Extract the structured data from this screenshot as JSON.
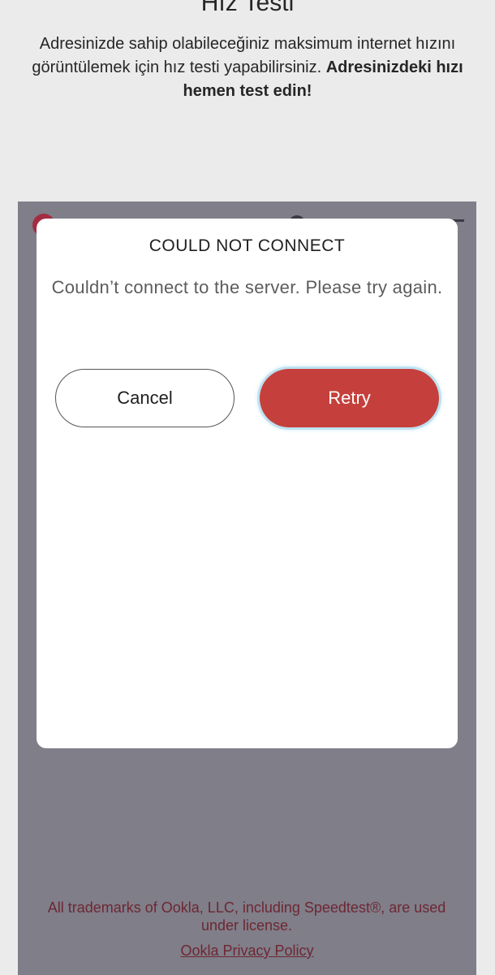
{
  "header": {
    "title": "Hız Testi",
    "intro_text": "Adresinizde sahip olabileceğiniz maksimum internet hızını görüntülemek için hız testi yapabilirsiniz.",
    "intro_bold": "Adresinizdeki hızı hemen test edin!"
  },
  "dialog": {
    "title": "COULD NOT CONNECT",
    "message": "Couldn’t connect to the server. Please try again.",
    "cancel_label": "Cancel",
    "retry_label": "Retry"
  },
  "footer": {
    "legal": "All trademarks of Ookla, LLC, including Speedtest®, are used under license.",
    "privacy_link": "Ookla Privacy Policy"
  },
  "colors": {
    "retry_button": "#c5403c",
    "overlay": "#7f7e89",
    "footer_text": "#6e2732"
  }
}
